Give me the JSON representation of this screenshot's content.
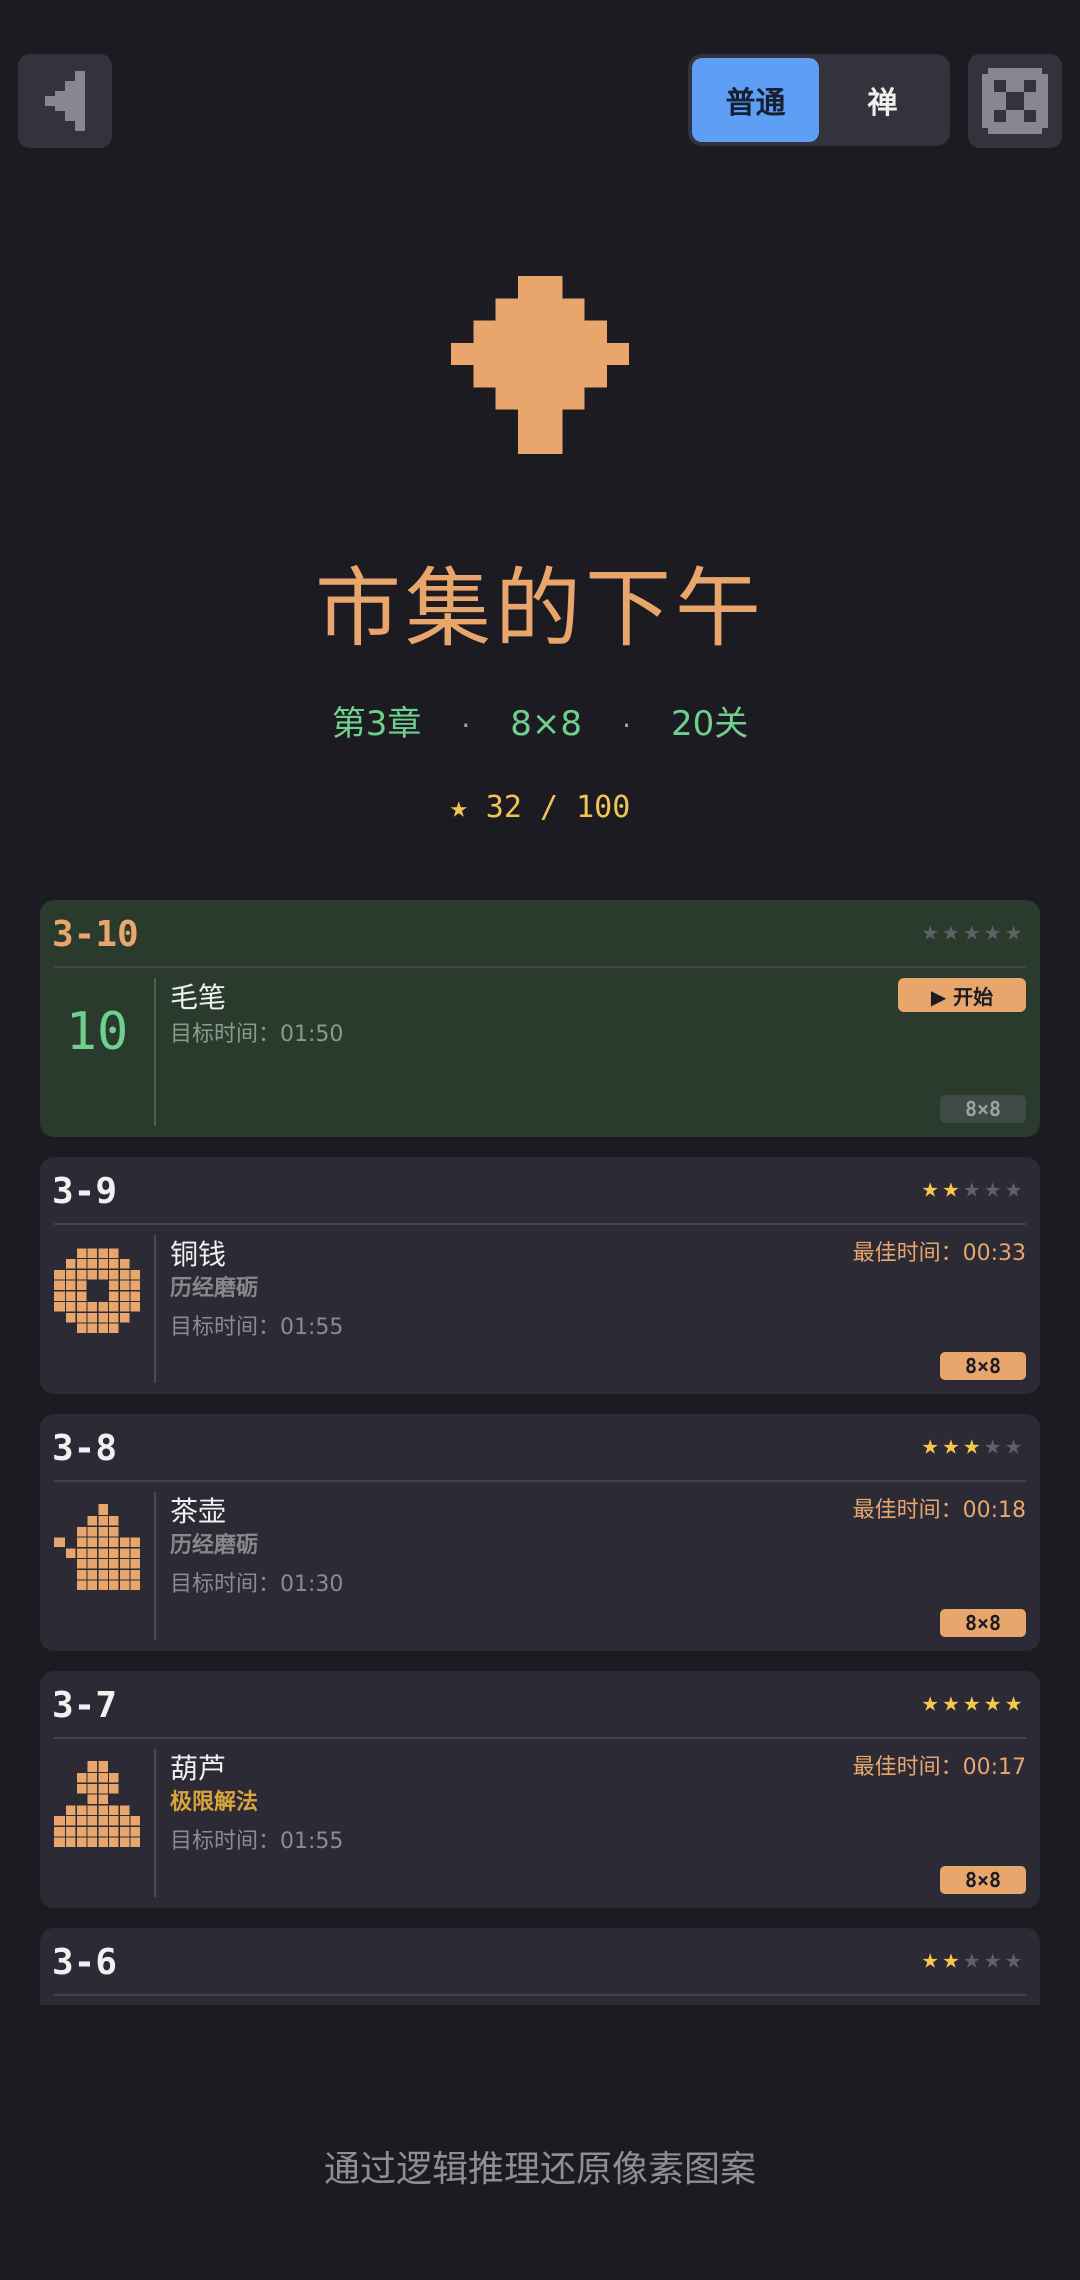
{
  "header": {
    "back_icon": "back-arrow-icon",
    "mode_normal": "普通",
    "mode_zen": "禅",
    "settings_icon": "pixel-grid-icon",
    "active_mode": "普通"
  },
  "chapter": {
    "icon": "pixel-shape-icon",
    "title": "市集的下午",
    "number": "第3章",
    "grid": "8×8",
    "levels": "20关",
    "stars_progress": "★ 32 / 100"
  },
  "levels": [
    {
      "id": "3-10",
      "name": "毛笔",
      "target": "目标时间：01:50",
      "stars": 0,
      "current": true,
      "thumb_number": "10",
      "action": "▶ 开始",
      "size": "8×8"
    },
    {
      "id": "3-9",
      "name": "铜钱",
      "tag": "历经磨砺",
      "target": "目标时间：01:55",
      "stars": 2,
      "best": "最佳时间：00:33",
      "size": "8×8"
    },
    {
      "id": "3-8",
      "name": "茶壶",
      "tag": "历经磨砺",
      "target": "目标时间：01:30",
      "stars": 3,
      "best": "最佳时间：00:18",
      "size": "8×8"
    },
    {
      "id": "3-7",
      "name": "葫芦",
      "tag": "极限解法",
      "target": "目标时间：01:55",
      "stars": 5,
      "best": "最佳时间：00:17",
      "size": "8×8"
    },
    {
      "id": "3-6",
      "stars": 2
    }
  ],
  "footer": "通过逻辑推理还原像素图案",
  "colors": {
    "accent": "#e8a66c",
    "green": "#6fcf8e",
    "blue": "#5e9ef5",
    "star": "#f5c84c",
    "bg": "#1c1b22",
    "card": "#2b2a35"
  }
}
